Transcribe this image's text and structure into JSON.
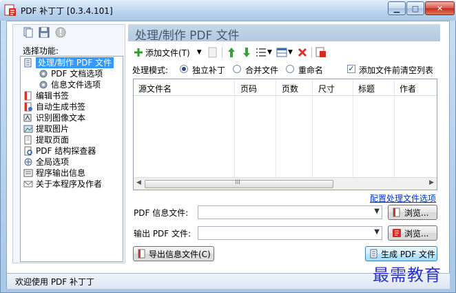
{
  "window": {
    "title": "PDF 补丁丁 [0.3.4.101]",
    "min_glyph": "▁",
    "max_glyph": "□",
    "close_glyph": "✕"
  },
  "left": {
    "select_label": "选择功能:",
    "items": [
      {
        "label": "处理/制作 PDF 文件",
        "icon": "doc-process-icon"
      },
      {
        "label": "PDF 文档选项",
        "icon": "gear-icon"
      },
      {
        "label": "信息文件选项",
        "icon": "gear-icon"
      },
      {
        "label": "编辑书签",
        "icon": "bookmark-icon"
      },
      {
        "label": "自动生成书签",
        "icon": "auto-bookmark-icon"
      },
      {
        "label": "识别图像文本",
        "icon": "ocr-icon"
      },
      {
        "label": "提取图片",
        "icon": "image-icon"
      },
      {
        "label": "提取页面",
        "icon": "page-icon"
      },
      {
        "label": "PDF 结构探查器",
        "icon": "explorer-icon"
      },
      {
        "label": "全局选项",
        "icon": "options-icon"
      },
      {
        "label": "程序输出信息",
        "icon": "log-icon"
      },
      {
        "label": "关于本程序及作者",
        "icon": "mail-icon"
      }
    ]
  },
  "main": {
    "header": "处理/制作 PDF 文件",
    "toolbar": {
      "add_files": "添加文件(T)"
    },
    "mode": {
      "label": "处理模式:",
      "options": [
        "独立补丁",
        "合并文件",
        "重命名"
      ],
      "selected_index": 0,
      "clear_list_label": "添加文件前清空列表",
      "clear_list_checked": true
    },
    "grid": {
      "columns": [
        "源文件名",
        "页码",
        "页数",
        "尺寸",
        "标题",
        "作者"
      ],
      "scroll_mark": "III"
    },
    "config_link": "配置处理文件选项",
    "info_file_label": "PDF 信息文件:",
    "output_label": "输出 PDF 文件:",
    "browse_label": "浏览...",
    "export_info_label": "导出信息文件(C)",
    "generate_label": "生成 PDF 文件"
  },
  "status": {
    "text": "欢迎使用 PDF 补丁丁"
  },
  "watermark": {
    "text": "最需教育"
  }
}
